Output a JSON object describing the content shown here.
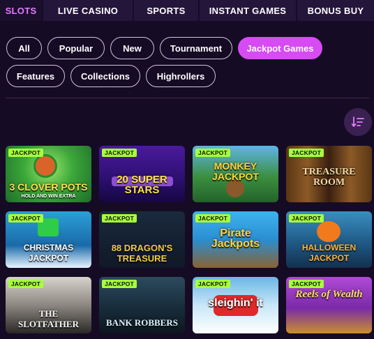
{
  "tabs": [
    {
      "label": "SLOTS",
      "active": true
    },
    {
      "label": "LIVE CASINO",
      "active": false
    },
    {
      "label": "SPORTS",
      "active": false
    },
    {
      "label": "INSTANT GAMES",
      "active": false
    },
    {
      "label": "BONUS BUY",
      "active": false
    }
  ],
  "filters": [
    {
      "label": "All",
      "active": false
    },
    {
      "label": "Popular",
      "active": false
    },
    {
      "label": "New",
      "active": false
    },
    {
      "label": "Tournament",
      "active": false
    },
    {
      "label": "Jackpot Games",
      "active": true
    },
    {
      "label": "Features",
      "active": false
    },
    {
      "label": "Collections",
      "active": false
    },
    {
      "label": "Highrollers",
      "active": false
    }
  ],
  "sort_button": {
    "icon": "sort-descending-icon"
  },
  "badge_label": "JACKPOT",
  "games": [
    {
      "title": "3 CLOVER POTS",
      "sub": "HOLD AND WIN EXTRA"
    },
    {
      "title": "20 SUPER STARS",
      "sub": ""
    },
    {
      "title": "MONKEY JACKPOT",
      "sub": ""
    },
    {
      "title": "TREASURE ROOM",
      "sub": ""
    },
    {
      "title": "CHRISTMAS JACKPOT",
      "sub": ""
    },
    {
      "title": "88 DRAGON'S TREASURE",
      "sub": ""
    },
    {
      "title": "Pirate Jackpots",
      "sub": ""
    },
    {
      "title": "HALLOWEEN JACKPOT",
      "sub": ""
    },
    {
      "title": "THE SLOTFATHER",
      "sub": ""
    },
    {
      "title": "BANK ROBBERS",
      "sub": ""
    },
    {
      "title": "sleighin' it",
      "sub": ""
    },
    {
      "title": "Reels of Wealth",
      "sub": ""
    }
  ],
  "colors": {
    "accent": "#d64bf2",
    "active_tab_text": "#e37cff",
    "badge": "#a6ff3b"
  }
}
